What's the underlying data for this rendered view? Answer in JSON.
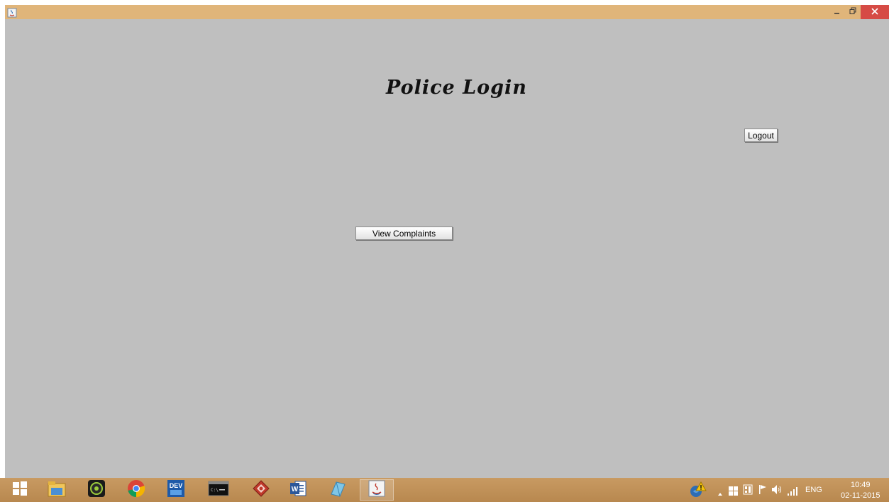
{
  "window": {
    "title": "",
    "controls": {
      "minimize_icon": "minimize-icon",
      "maximize_icon": "restore-icon",
      "close_icon": "close-icon"
    }
  },
  "main": {
    "title": "Police Login",
    "logout_label": "Logout",
    "view_complaints_label": "View Complaints"
  },
  "taskbar": {
    "apps": [
      {
        "name": "start-icon"
      },
      {
        "name": "file-explorer-icon"
      },
      {
        "name": "camera-app-icon"
      },
      {
        "name": "chrome-icon"
      },
      {
        "name": "dev-cpp-icon"
      },
      {
        "name": "command-prompt-icon"
      },
      {
        "name": "red-app-icon"
      },
      {
        "name": "word-icon"
      },
      {
        "name": "blue-app-icon"
      },
      {
        "name": "java-icon"
      }
    ],
    "tray": {
      "language": "ENG",
      "time": "10:49",
      "date": "02-11-2015"
    }
  },
  "colors": {
    "window_background": "#bfbfbf",
    "titlebar": "#e0b57a",
    "taskbar": "#c0925a",
    "close_button": "#d64b45"
  }
}
